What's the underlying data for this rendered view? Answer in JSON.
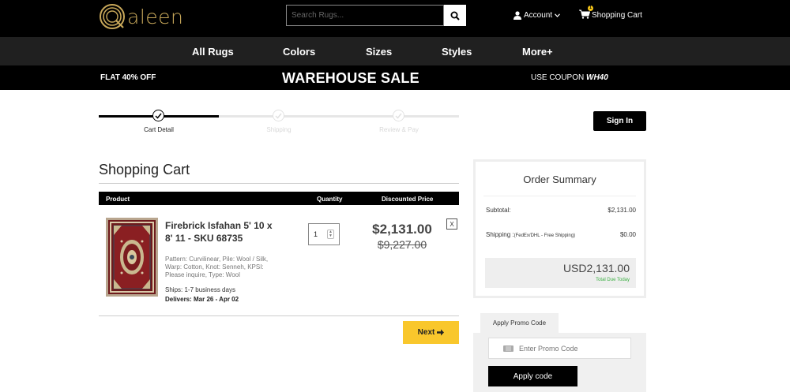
{
  "header": {
    "logo_text": "aleen",
    "search_placeholder": "Search Rugs...",
    "account_label": "Account",
    "cart_label": "Shopping Cart",
    "cart_count": "1"
  },
  "nav": {
    "items": [
      "All Rugs",
      "Colors",
      "Sizes",
      "Styles",
      "More+"
    ]
  },
  "banner": {
    "left": "FLAT 40% OFF",
    "center": "WAREHOUSE SALE",
    "right_prefix": "USE COUPON",
    "coupon_code": "WH40"
  },
  "steps": [
    {
      "label": "Cart Detail",
      "active": true
    },
    {
      "label": "Shipping",
      "active": false
    },
    {
      "label": "Review & Pay",
      "active": false
    }
  ],
  "signin_label": "Sign In",
  "cart": {
    "title": "Shopping Cart",
    "columns": [
      "Product",
      "Quantity",
      "Discounted Price"
    ],
    "item": {
      "name": "Firebrick Isfahan 5' 10 x 8' 11 - SKU 68735",
      "attributes": "Pattern: Curvilinear, Pile: Wool / Silk, Warp: Cotton, Knot: Senneh, KPSI: Please inquire, Type: Wool",
      "ships": "Ships: 1-7 business days",
      "delivers": "Delivers: Mar 26 - Apr 02",
      "quantity": "1",
      "price": "$2,131.00",
      "original_price": "$9,227.00",
      "remove_label": "X"
    },
    "next_label": "Next"
  },
  "summary": {
    "title": "Order Summary",
    "subtotal_label": "Subtotal:",
    "subtotal_value": "$2,131.00",
    "shipping_label": "Shipping :",
    "shipping_note": "(FedEx/DHL - Free Shipping)",
    "shipping_value": "$0.00",
    "total": "USD2,131.00",
    "total_note": "Total Due Today"
  },
  "promo": {
    "tab_label": "Apply Promo Code",
    "input_placeholder": "Enter Promo Code",
    "apply_label": "Apply code"
  },
  "colors": {
    "brand_gold": "#c8a85a",
    "next_button": "#f9c72c",
    "total_due_green": "#3cb043"
  }
}
